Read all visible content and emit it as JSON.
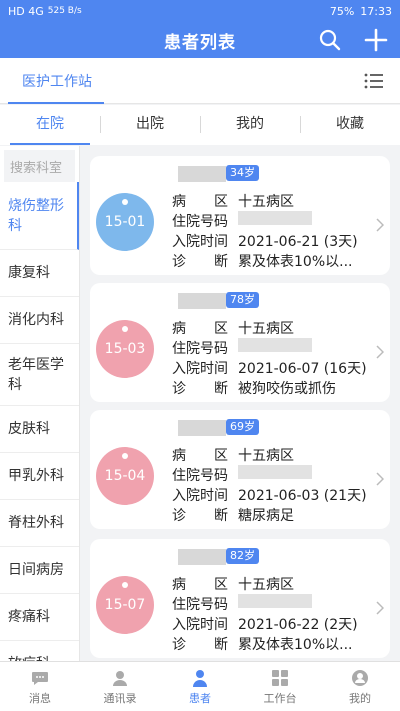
{
  "status_bar": {
    "network": "HD 4G",
    "speed": "525 B/s",
    "battery": "75%",
    "time": "17:33"
  },
  "header": {
    "title": "患者列表",
    "search_icon": "search-icon",
    "add_icon": "plus-icon"
  },
  "workstation": {
    "label": "医护工作站",
    "menu_icon": "list-menu-icon"
  },
  "tabs": [
    "在院",
    "出院",
    "我的",
    "收藏"
  ],
  "sidebar": {
    "search_placeholder": "搜索科室",
    "items": [
      "烧伤整形科",
      "康复科",
      "消化内科",
      "老年医学科",
      "皮肤科",
      "甲乳外科",
      "脊柱外科",
      "日间病房",
      "疼痛科",
      "放疗科"
    ]
  },
  "field_labels": {
    "ward": "病　　区",
    "admission_no": "住院号码",
    "admission_time": "入院时间",
    "diagnosis": "诊　　断"
  },
  "patients": [
    {
      "age": "34岁",
      "bed": "15-01",
      "ward": "十五病区",
      "admit": "2021-06-21 (3天)",
      "diagnosis": "累及体表10%以...",
      "tag_color": "#7eb8ec"
    },
    {
      "age": "78岁",
      "bed": "15-03",
      "ward": "十五病区",
      "admit": "2021-06-07 (16天)",
      "diagnosis": "被狗咬伤或抓伤",
      "tag_color": "#f0a2ae"
    },
    {
      "age": "69岁",
      "bed": "15-04",
      "ward": "十五病区",
      "admit": "2021-06-03 (21天)",
      "diagnosis": "糖尿病足",
      "tag_color": "#f0a2ae"
    },
    {
      "age": "82岁",
      "bed": "15-07",
      "ward": "十五病区",
      "admit": "2021-06-22 (2天)",
      "diagnosis": "累及体表10%以...",
      "tag_color": "#f0a2ae"
    }
  ],
  "bottom_nav": [
    {
      "label": "消息",
      "icon": "message-icon"
    },
    {
      "label": "通讯录",
      "icon": "contacts-icon"
    },
    {
      "label": "患者",
      "icon": "patient-icon"
    },
    {
      "label": "工作台",
      "icon": "workbench-icon"
    },
    {
      "label": "我的",
      "icon": "profile-icon"
    }
  ],
  "colors": {
    "accent": "#4f86f0",
    "blue_tag": "#7eb8ec",
    "pink_tag": "#f0a2ae"
  }
}
